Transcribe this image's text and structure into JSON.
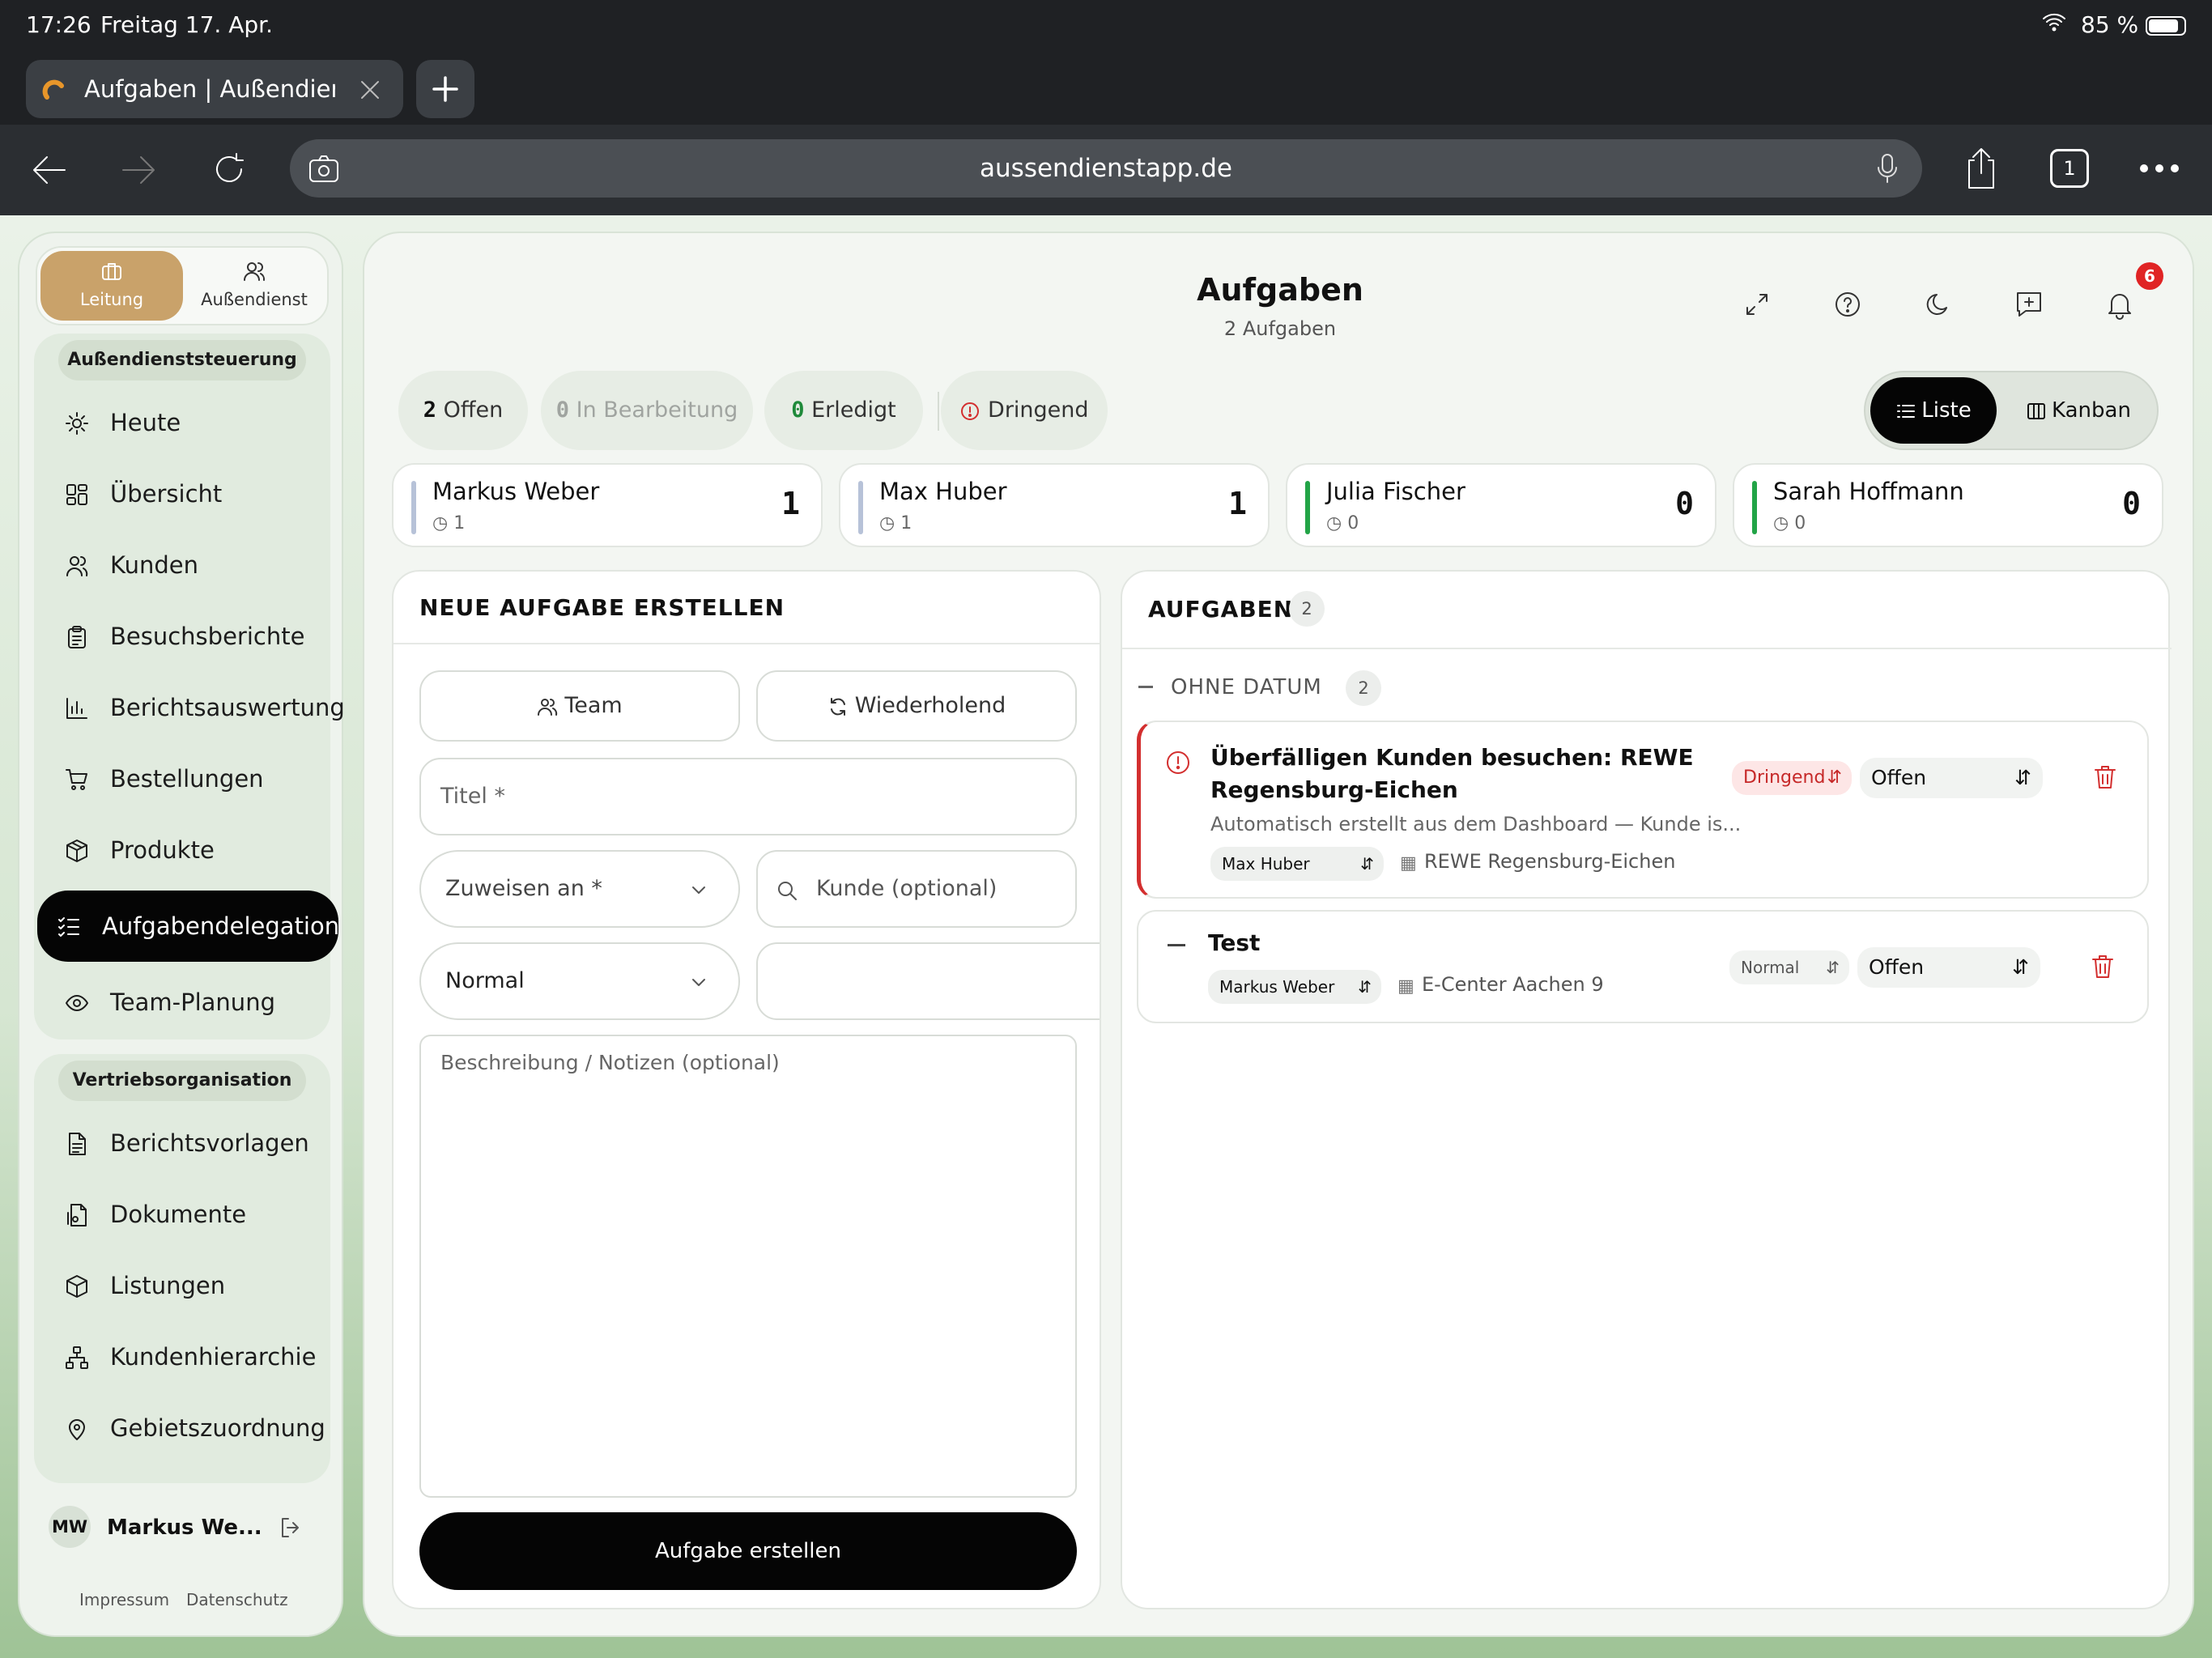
{
  "status_bar": {
    "time": "17:26",
    "date": "Freitag 17. Apr.",
    "battery": "85 %"
  },
  "browser": {
    "tab_title": "Aufgaben | Außendienst",
    "url": "aussendienstapp.de",
    "tab_count": "1"
  },
  "sidebar": {
    "roles": [
      {
        "label": "Leitung",
        "active": true
      },
      {
        "label": "Außendienst",
        "active": false
      }
    ],
    "section1": "Außendienststeuerung",
    "section1_items": [
      "Heute",
      "Übersicht",
      "Kunden",
      "Besuchsberichte",
      "Berichtsauswertung",
      "Bestellungen",
      "Produkte",
      "Aufgabendelegation",
      "Team-Planung"
    ],
    "section2": "Vertriebsorganisation",
    "section2_items": [
      "Berichtsvorlagen",
      "Dokumente",
      "Listungen",
      "Kundenhierarchie",
      "Gebietszuordnung"
    ],
    "user_initials": "MW",
    "user_name": "Markus We...",
    "footer_links": [
      "Impressum",
      "Datenschutz"
    ]
  },
  "header": {
    "title": "Aufgaben",
    "subtitle": "2 Aufgaben",
    "notification_count": "6"
  },
  "filters": {
    "open_count": "2",
    "open_label": "Offen",
    "progress_count": "0",
    "progress_label": "In Bearbeitung",
    "done_count": "0",
    "done_label": "Erledigt",
    "urgent_label": "Dringend"
  },
  "view_toggle": {
    "list": "Liste",
    "kanban": "Kanban",
    "active": "Liste"
  },
  "team_stats": [
    {
      "name": "Markus Weber",
      "sub": "1",
      "count": "1",
      "color": "#b7c2d8"
    },
    {
      "name": "Max Huber",
      "sub": "1",
      "count": "1",
      "color": "#b7c2d8"
    },
    {
      "name": "Julia Fischer",
      "sub": "0",
      "count": "0",
      "color": "#22a447"
    },
    {
      "name": "Sarah Hoffmann",
      "sub": "0",
      "count": "0",
      "color": "#22a447"
    }
  ],
  "new_task": {
    "heading": "NEUE AUFGABE ERSTELLEN",
    "team_button": "Team",
    "recurring_button": "Wiederholend",
    "title_placeholder": "Titel *",
    "assign_placeholder": "Zuweisen an *",
    "customer_placeholder": "Kunde (optional)",
    "priority_value": "Normal",
    "date_value": "",
    "description_placeholder": "Beschreibung / Notizen (optional)",
    "submit": "Aufgabe erstellen"
  },
  "task_list": {
    "heading": "AUFGABEN",
    "count": "2",
    "group_label": "OHNE DATUM",
    "group_count": "2",
    "tasks": [
      {
        "title_line1": "Überfälligen Kunden besuchen: REWE",
        "title_line2": "Regensburg-Eichen",
        "description": "Automatisch erstellt aus dem Dashboard — Kunde is...",
        "assignee": "Max Huber",
        "customer": "REWE Regensburg-Eichen",
        "priority": "Dringend",
        "status": "Offen"
      },
      {
        "title_line1": "Test",
        "assignee": "Markus Weber",
        "customer": "E-Center Aachen 9",
        "priority": "Normal",
        "status": "Offen"
      }
    ]
  },
  "colors": {
    "accent_gold": "#c9a26a",
    "urgent_red": "#d32f2f",
    "active_black": "#050505"
  }
}
